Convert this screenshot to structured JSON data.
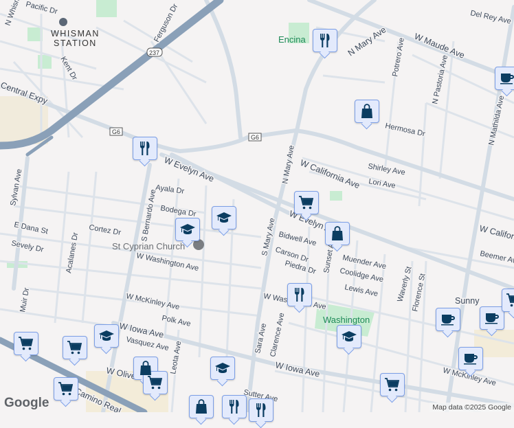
{
  "map": {
    "places": [
      "WHISMAN",
      "STATION"
    ],
    "poi": [
      "Encina",
      "Washington",
      "St Cyprian Church",
      "Sunny"
    ],
    "shields": [
      "237",
      "G6",
      "G6"
    ],
    "streets": [
      "N Whisman",
      "Pacific Dr",
      "Ferguson Dr",
      "Kent Dr",
      "Central Expy",
      "W Evelyn Ave",
      "Ayala Dr",
      "S Bernardo Ave",
      "Sylvan Ave",
      "Bodega Dr",
      "Cortez Dr",
      "E Dana St",
      "Sevely Dr",
      "Acalanes Dr",
      "W Washington Ave",
      "Muir Dr",
      "W McKinley Ave",
      "Polk Ave",
      "W Iowa Ave",
      "Vasquez Ave",
      "W Olive",
      "Leota Ave",
      "Sutter Ave",
      "Camino Real",
      "Del Rey Ave",
      "N Mary Ave",
      "W Maude Ave",
      "Potrero Ave",
      "N Pastoria Ave",
      "N Mathilda Ave",
      "Hermosa Dr",
      "N Mary Ave",
      "W California Ave",
      "Shirley Ave",
      "Lori Ave",
      "W Evelyn Ave",
      "S Mary Ave",
      "Bidwell Ave",
      "Carson Dr",
      "Piedra Dr",
      "Sunset Ave",
      "Muender Ave",
      "Coolidge Ave",
      "Lewis Ave",
      "W Washington Ave",
      "Waverly St",
      "Florence St",
      "W California Ave",
      "Beemer Ave",
      "W McKinley Ave",
      "W Iowa Ave",
      "Sara Ave",
      "Clarence Ave"
    ]
  },
  "markers": [
    {
      "type": "restaurant",
      "icon": "fork-knife-icon"
    },
    {
      "type": "restaurant",
      "icon": "fork-knife-icon"
    },
    {
      "type": "shopping",
      "icon": "shopping-bag-icon"
    },
    {
      "type": "cafe",
      "icon": "coffee-cup-icon"
    },
    {
      "type": "grocery",
      "icon": "shopping-cart-icon"
    },
    {
      "type": "shopping",
      "icon": "shopping-bag-icon"
    },
    {
      "type": "school",
      "icon": "graduation-cap-icon"
    },
    {
      "type": "school",
      "icon": "graduation-cap-icon"
    },
    {
      "type": "restaurant",
      "icon": "fork-knife-icon"
    },
    {
      "type": "school",
      "icon": "graduation-cap-icon"
    },
    {
      "type": "cafe",
      "icon": "coffee-cup-icon"
    },
    {
      "type": "cafe",
      "icon": "coffee-cup-icon"
    },
    {
      "type": "cafe",
      "icon": "coffee-cup-icon"
    },
    {
      "type": "grocery",
      "icon": "shopping-cart-icon"
    },
    {
      "type": "grocery",
      "icon": "shopping-cart-icon"
    },
    {
      "type": "grocery",
      "icon": "shopping-cart-icon"
    },
    {
      "type": "school",
      "icon": "graduation-cap-icon"
    },
    {
      "type": "shopping",
      "icon": "shopping-bag-icon"
    },
    {
      "type": "grocery",
      "icon": "shopping-cart-icon"
    },
    {
      "type": "school",
      "icon": "graduation-cap-icon"
    },
    {
      "type": "grocery",
      "icon": "shopping-cart-icon"
    },
    {
      "type": "shopping",
      "icon": "shopping-bag-icon"
    },
    {
      "type": "restaurant",
      "icon": "fork-knife-icon"
    },
    {
      "type": "restaurant",
      "icon": "fork-knife-icon"
    },
    {
      "type": "grocery",
      "icon": "shopping-cart-icon"
    }
  ],
  "footer": {
    "logo": "Google",
    "attribution": "Map data ©2025 Google"
  },
  "colors": {
    "marker_fill": "#e3eafc",
    "marker_icon": "#0b3d61",
    "highway": "#8aa0b8",
    "park": "#c8ecd2"
  }
}
